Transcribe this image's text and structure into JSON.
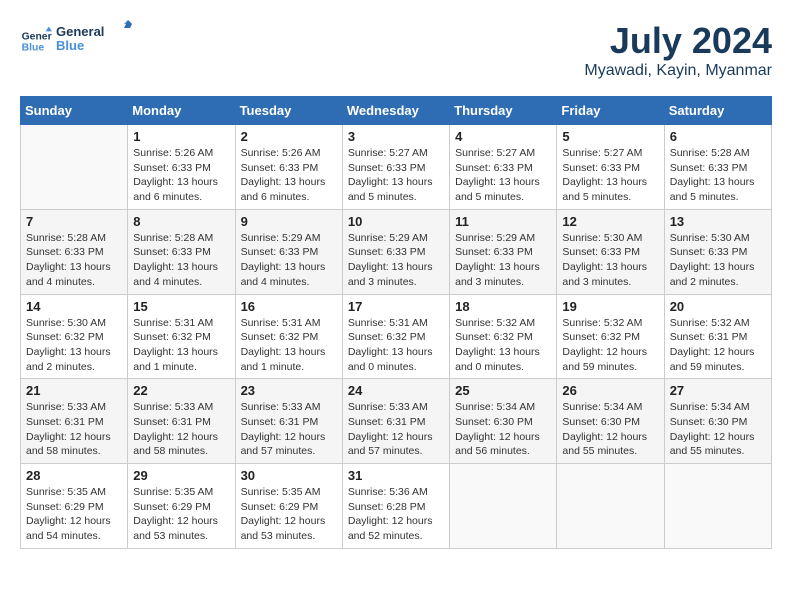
{
  "header": {
    "logo_line1": "General",
    "logo_line2": "Blue",
    "month_year": "July 2024",
    "location": "Myawadi, Kayin, Myanmar"
  },
  "columns": [
    "Sunday",
    "Monday",
    "Tuesday",
    "Wednesday",
    "Thursday",
    "Friday",
    "Saturday"
  ],
  "weeks": [
    [
      {
        "day": "",
        "sunrise": "",
        "sunset": "",
        "daylight": ""
      },
      {
        "day": "1",
        "sunrise": "Sunrise: 5:26 AM",
        "sunset": "Sunset: 6:33 PM",
        "daylight": "Daylight: 13 hours and 6 minutes."
      },
      {
        "day": "2",
        "sunrise": "Sunrise: 5:26 AM",
        "sunset": "Sunset: 6:33 PM",
        "daylight": "Daylight: 13 hours and 6 minutes."
      },
      {
        "day": "3",
        "sunrise": "Sunrise: 5:27 AM",
        "sunset": "Sunset: 6:33 PM",
        "daylight": "Daylight: 13 hours and 5 minutes."
      },
      {
        "day": "4",
        "sunrise": "Sunrise: 5:27 AM",
        "sunset": "Sunset: 6:33 PM",
        "daylight": "Daylight: 13 hours and 5 minutes."
      },
      {
        "day": "5",
        "sunrise": "Sunrise: 5:27 AM",
        "sunset": "Sunset: 6:33 PM",
        "daylight": "Daylight: 13 hours and 5 minutes."
      },
      {
        "day": "6",
        "sunrise": "Sunrise: 5:28 AM",
        "sunset": "Sunset: 6:33 PM",
        "daylight": "Daylight: 13 hours and 5 minutes."
      }
    ],
    [
      {
        "day": "7",
        "sunrise": "Sunrise: 5:28 AM",
        "sunset": "Sunset: 6:33 PM",
        "daylight": "Daylight: 13 hours and 4 minutes."
      },
      {
        "day": "8",
        "sunrise": "Sunrise: 5:28 AM",
        "sunset": "Sunset: 6:33 PM",
        "daylight": "Daylight: 13 hours and 4 minutes."
      },
      {
        "day": "9",
        "sunrise": "Sunrise: 5:29 AM",
        "sunset": "Sunset: 6:33 PM",
        "daylight": "Daylight: 13 hours and 4 minutes."
      },
      {
        "day": "10",
        "sunrise": "Sunrise: 5:29 AM",
        "sunset": "Sunset: 6:33 PM",
        "daylight": "Daylight: 13 hours and 3 minutes."
      },
      {
        "day": "11",
        "sunrise": "Sunrise: 5:29 AM",
        "sunset": "Sunset: 6:33 PM",
        "daylight": "Daylight: 13 hours and 3 minutes."
      },
      {
        "day": "12",
        "sunrise": "Sunrise: 5:30 AM",
        "sunset": "Sunset: 6:33 PM",
        "daylight": "Daylight: 13 hours and 3 minutes."
      },
      {
        "day": "13",
        "sunrise": "Sunrise: 5:30 AM",
        "sunset": "Sunset: 6:33 PM",
        "daylight": "Daylight: 13 hours and 2 minutes."
      }
    ],
    [
      {
        "day": "14",
        "sunrise": "Sunrise: 5:30 AM",
        "sunset": "Sunset: 6:32 PM",
        "daylight": "Daylight: 13 hours and 2 minutes."
      },
      {
        "day": "15",
        "sunrise": "Sunrise: 5:31 AM",
        "sunset": "Sunset: 6:32 PM",
        "daylight": "Daylight: 13 hours and 1 minute."
      },
      {
        "day": "16",
        "sunrise": "Sunrise: 5:31 AM",
        "sunset": "Sunset: 6:32 PM",
        "daylight": "Daylight: 13 hours and 1 minute."
      },
      {
        "day": "17",
        "sunrise": "Sunrise: 5:31 AM",
        "sunset": "Sunset: 6:32 PM",
        "daylight": "Daylight: 13 hours and 0 minutes."
      },
      {
        "day": "18",
        "sunrise": "Sunrise: 5:32 AM",
        "sunset": "Sunset: 6:32 PM",
        "daylight": "Daylight: 13 hours and 0 minutes."
      },
      {
        "day": "19",
        "sunrise": "Sunrise: 5:32 AM",
        "sunset": "Sunset: 6:32 PM",
        "daylight": "Daylight: 12 hours and 59 minutes."
      },
      {
        "day": "20",
        "sunrise": "Sunrise: 5:32 AM",
        "sunset": "Sunset: 6:31 PM",
        "daylight": "Daylight: 12 hours and 59 minutes."
      }
    ],
    [
      {
        "day": "21",
        "sunrise": "Sunrise: 5:33 AM",
        "sunset": "Sunset: 6:31 PM",
        "daylight": "Daylight: 12 hours and 58 minutes."
      },
      {
        "day": "22",
        "sunrise": "Sunrise: 5:33 AM",
        "sunset": "Sunset: 6:31 PM",
        "daylight": "Daylight: 12 hours and 58 minutes."
      },
      {
        "day": "23",
        "sunrise": "Sunrise: 5:33 AM",
        "sunset": "Sunset: 6:31 PM",
        "daylight": "Daylight: 12 hours and 57 minutes."
      },
      {
        "day": "24",
        "sunrise": "Sunrise: 5:33 AM",
        "sunset": "Sunset: 6:31 PM",
        "daylight": "Daylight: 12 hours and 57 minutes."
      },
      {
        "day": "25",
        "sunrise": "Sunrise: 5:34 AM",
        "sunset": "Sunset: 6:30 PM",
        "daylight": "Daylight: 12 hours and 56 minutes."
      },
      {
        "day": "26",
        "sunrise": "Sunrise: 5:34 AM",
        "sunset": "Sunset: 6:30 PM",
        "daylight": "Daylight: 12 hours and 55 minutes."
      },
      {
        "day": "27",
        "sunrise": "Sunrise: 5:34 AM",
        "sunset": "Sunset: 6:30 PM",
        "daylight": "Daylight: 12 hours and 55 minutes."
      }
    ],
    [
      {
        "day": "28",
        "sunrise": "Sunrise: 5:35 AM",
        "sunset": "Sunset: 6:29 PM",
        "daylight": "Daylight: 12 hours and 54 minutes."
      },
      {
        "day": "29",
        "sunrise": "Sunrise: 5:35 AM",
        "sunset": "Sunset: 6:29 PM",
        "daylight": "Daylight: 12 hours and 53 minutes."
      },
      {
        "day": "30",
        "sunrise": "Sunrise: 5:35 AM",
        "sunset": "Sunset: 6:29 PM",
        "daylight": "Daylight: 12 hours and 53 minutes."
      },
      {
        "day": "31",
        "sunrise": "Sunrise: 5:36 AM",
        "sunset": "Sunset: 6:28 PM",
        "daylight": "Daylight: 12 hours and 52 minutes."
      },
      {
        "day": "",
        "sunrise": "",
        "sunset": "",
        "daylight": ""
      },
      {
        "day": "",
        "sunrise": "",
        "sunset": "",
        "daylight": ""
      },
      {
        "day": "",
        "sunrise": "",
        "sunset": "",
        "daylight": ""
      }
    ]
  ]
}
